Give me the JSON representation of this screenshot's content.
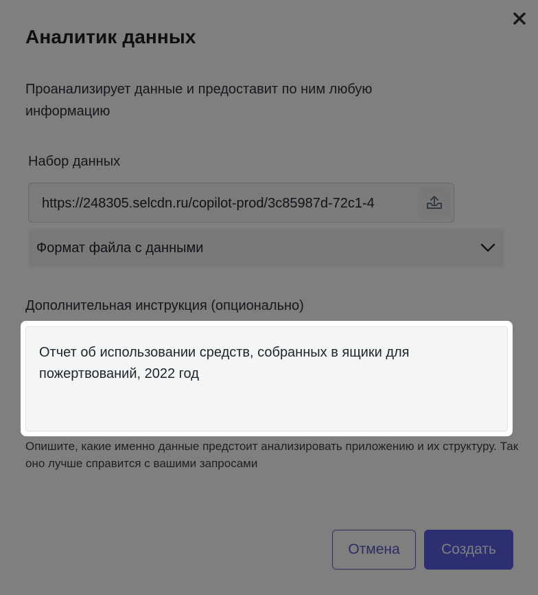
{
  "dialog": {
    "title": "Аналитик данных",
    "description": "Проанализирует данные и предоставит по ним любую информацию",
    "close_icon": "close-icon"
  },
  "dataset": {
    "label": "Набор данных",
    "value": "https://248305.selcdn.ru/copilot-prod/3c85987d-72c1-4",
    "upload_icon": "upload-icon"
  },
  "format_select": {
    "label": "Формат файла с данными",
    "chevron_icon": "chevron-down-icon"
  },
  "instruction": {
    "label": "Дополнительная инструкция (опционально)",
    "value": "Отчет об использовании средств, собранных в ящики для пожертвований, 2022 год",
    "hint": "Опишите, какие именно данные предстоит анализировать приложению и их структуру. Так оно лучше справится с вашими запросами"
  },
  "buttons": {
    "cancel": "Отмена",
    "create": "Создать"
  },
  "colors": {
    "accent": "#5c5ce6",
    "overlay": "rgba(0,0,0,0.5)"
  }
}
